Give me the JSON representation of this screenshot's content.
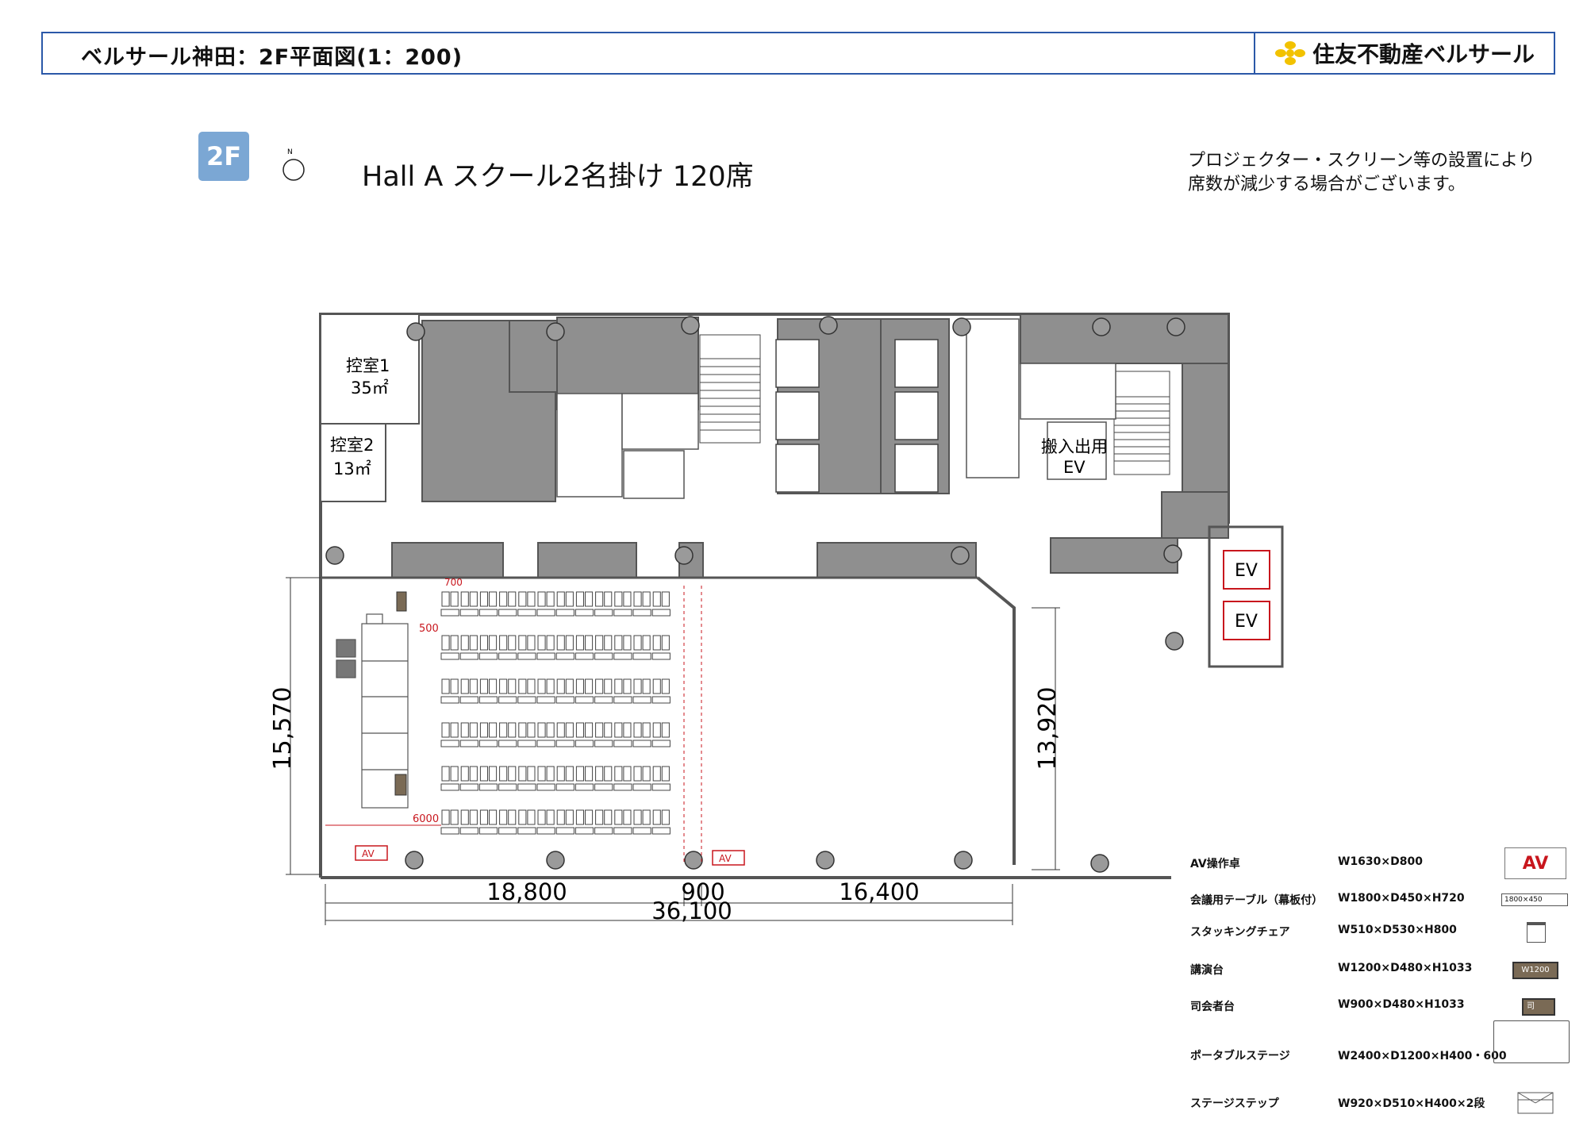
{
  "header": {
    "title": "ベルサール神田：2F平面図(1：200)",
    "brand_name": "住友不動産ベルサール"
  },
  "floor_badge": "2F",
  "compass": {
    "north_label": "N"
  },
  "layout_title": "Hall A スクール2名掛け 120席",
  "note": {
    "line1": "プロジェクター・スクリーン等の設置により",
    "line2": "席数が減少する場合がございます。"
  },
  "rooms": {
    "hikae1_name": "控室1",
    "hikae1_area": "35㎡",
    "hikae2_name": "控室2",
    "hikae2_area": "13㎡",
    "freight_ev_line1": "搬入出用",
    "freight_ev_line2": "EV",
    "ev1": "EV",
    "ev2": "EV",
    "av_label_left": "AV",
    "av_label_center": "AV"
  },
  "dimensions": {
    "height_left": "15,570",
    "height_right": "13,920",
    "width_left": "18,800",
    "width_mid": "900",
    "width_right": "16,400",
    "width_total": "36,100",
    "red_700": "700",
    "red_500": "500",
    "red_6000": "6000"
  },
  "seating": {
    "rows": 6,
    "tables_per_row": 12,
    "chairs_per_table": 2,
    "total_seats": 120
  },
  "legend": [
    {
      "name": "AV操作卓",
      "dims": "W1630×D800",
      "symbol_text": "AV"
    },
    {
      "name": "会議用テーブル（幕板付）",
      "dims": "W1800×D450×H720",
      "symbol_text": "1800×450"
    },
    {
      "name": "スタッキングチェア",
      "dims": "W510×D530×H800",
      "symbol_text": ""
    },
    {
      "name": "講演台",
      "dims": "W1200×D480×H1033",
      "symbol_text": "W1200"
    },
    {
      "name": "司会者台",
      "dims": "W900×D480×H1033",
      "symbol_text": "司"
    },
    {
      "name": "ポータブルステージ",
      "dims": "W2400×D1200×H400・600",
      "symbol_text": ""
    },
    {
      "name": "ステージステップ",
      "dims": "W920×D510×H400×2段",
      "symbol_text": ""
    }
  ],
  "colors": {
    "frame_blue": "#2b58a8",
    "badge_blue": "#7ba7d4",
    "core_gray": "#8a8a8a",
    "dim_red": "#c8161d",
    "logo_yellow": "#f2c200",
    "podium_brown": "#7a6a55"
  }
}
